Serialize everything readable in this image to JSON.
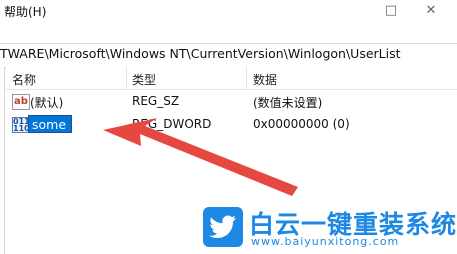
{
  "menu": {
    "help_label": "帮助(H)"
  },
  "window_controls": {
    "maximize": "□",
    "close": "✕"
  },
  "address_bar": {
    "path": "TWARE\\Microsoft\\Windows NT\\CurrentVersion\\Winlogon\\UserList"
  },
  "columns": {
    "name": "名称",
    "type": "类型",
    "data": "数据"
  },
  "rows": [
    {
      "icon": "string-value-icon",
      "icon_text": "ab",
      "name": "(默认)",
      "type": "REG_SZ",
      "data": "(数值未设置)"
    },
    {
      "icon": "binary-value-icon",
      "icon_text": "011 110",
      "name": "some",
      "type": "REG_DWORD",
      "data": "0x00000000 (0)",
      "selected": true
    }
  ],
  "watermark": {
    "title": "白云一键重装系统",
    "url": "www.baiyunxitong.com",
    "brand_color": "#1e88e5"
  },
  "annotation_color": "#e5483f"
}
